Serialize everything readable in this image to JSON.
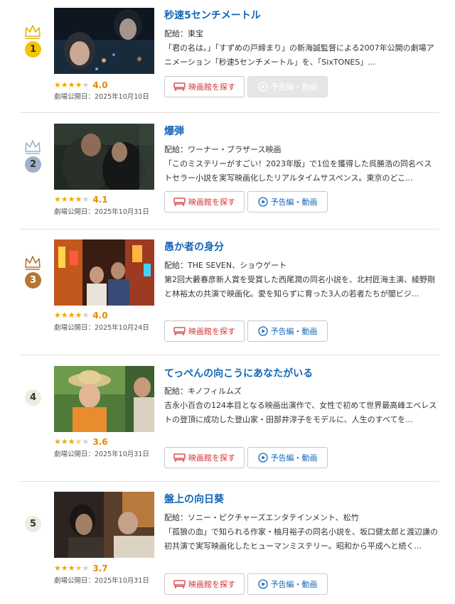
{
  "labels": {
    "distributor_prefix": "配給：",
    "release_prefix": "劇場公開日：",
    "theater_button": "映画館を探す",
    "trailer_button": "予告編・動画"
  },
  "items": [
    {
      "rank": "1",
      "crown": "gold",
      "title": "秒速5センチメートル",
      "distributor": "配給：東宝",
      "synopsis": "「君の名は。」「すずめの戸締まり」の新海誠監督による2007年公開の劇場アニメーション「秒速5センチメートル」を、「SixTONES」...",
      "stars": 4.0,
      "score": "4.0",
      "release": "劇場公開日：2025年10月10日",
      "trailer_enabled": false
    },
    {
      "rank": "2",
      "crown": "silver",
      "title": "爆弾",
      "distributor": "配給：ワーナー・ブラザース映画",
      "synopsis": "「このミステリーがすごい！2023年版」で1位を獲得した呉勝浩の同名ベストセラー小説を実写映画化したリアルタイムサスペンス。東京のどこ...",
      "stars": 4.1,
      "score": "4.1",
      "release": "劇場公開日：2025年10月31日",
      "trailer_enabled": true
    },
    {
      "rank": "3",
      "crown": "bronze",
      "title": "愚か者の身分",
      "distributor": "配給：THE SEVEN、ショウゲート",
      "synopsis": "第2回大藪春彦新人賞を受賞した西尾潤の同名小説を、北村匠海主演、綾野剛と林裕太の共演で映画化。愛を知らずに育った3人の若者たちが闇ビジ...",
      "stars": 4.0,
      "score": "4.0",
      "release": "劇場公開日：2025年10月24日",
      "trailer_enabled": true
    },
    {
      "rank": "4",
      "crown": "none",
      "title": "てっぺんの向こうにあなたがいる",
      "distributor": "配給：キノフィルムズ",
      "synopsis": "吉永小百合の124本目となる映画出演作で、女性で初めて世界最高峰エベレストの登頂に成功した登山家・田部井淳子をモデルに、人生のすべてを...",
      "stars": 3.6,
      "score": "3.6",
      "release": "劇場公開日：2025年10月31日",
      "trailer_enabled": true
    },
    {
      "rank": "5",
      "crown": "none",
      "title": "盤上の向日葵",
      "distributor": "配給：ソニー・ピクチャーズエンタテインメント、松竹",
      "synopsis": "「孤狼の血」で知られる作家・柚月裕子の同名小説を、坂口健太郎と渡辺謙の初共演で実写映画化したヒューマンミステリー。昭和から平成へと続く...",
      "stars": 3.7,
      "score": "3.7",
      "release": "劇場公開日：2025年10月31日",
      "trailer_enabled": true
    }
  ],
  "colors": {
    "title": "#1466b8",
    "score": "#e48a00",
    "star": "#f0a800",
    "theater_button_text": "#d53333",
    "gold": "#f5c400",
    "silver": "#9fb1c6",
    "bronze": "#b5762f"
  },
  "icons": {
    "crown": "crown-icon",
    "theater": "theater-seat-icon",
    "play": "play-circle-icon"
  }
}
